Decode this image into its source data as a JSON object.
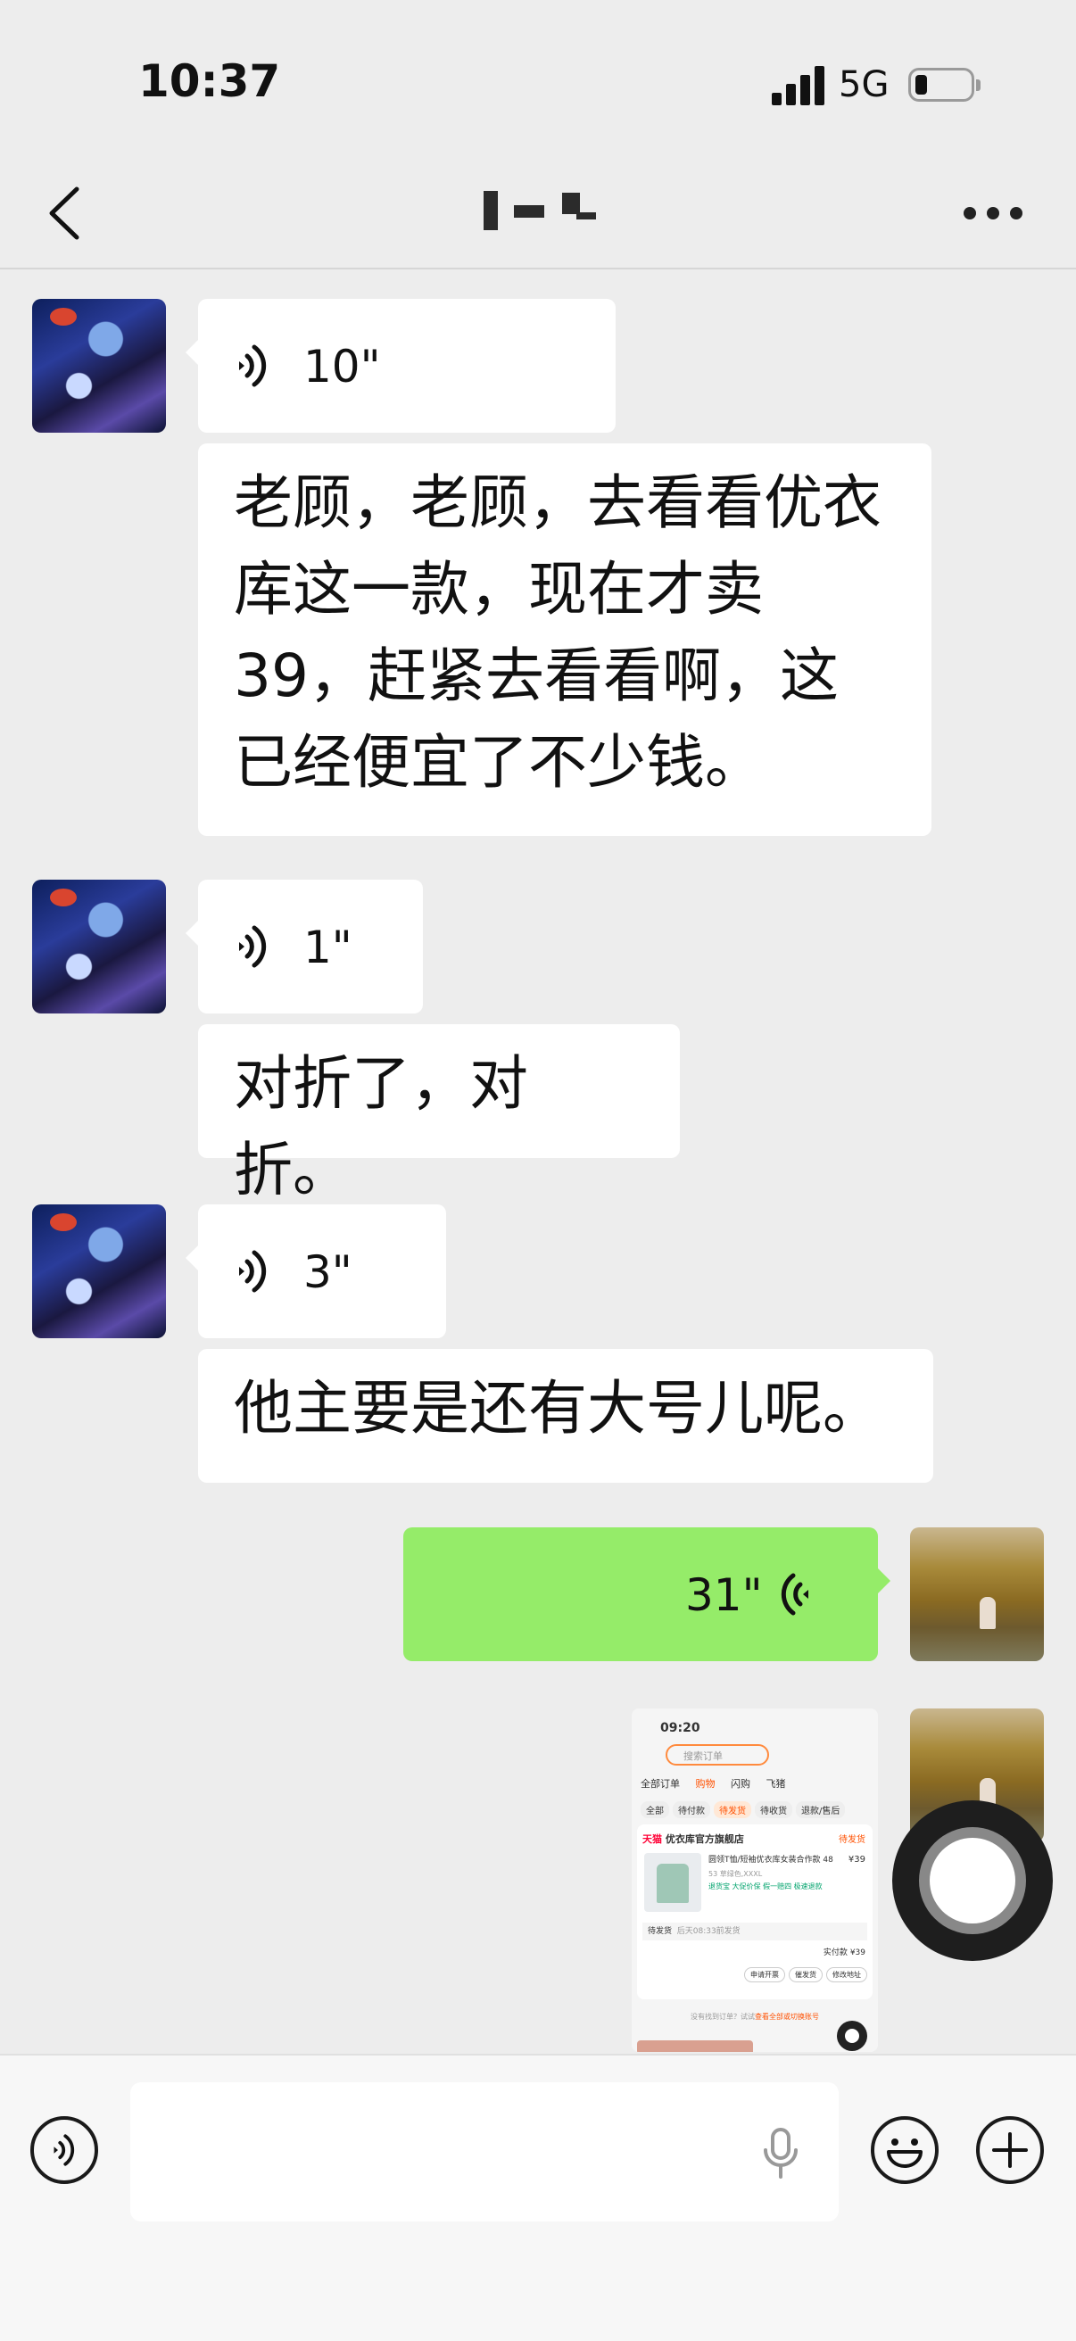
{
  "status_bar": {
    "time": "10:37",
    "network": "5G"
  },
  "nav": {
    "back_icon": "chevron-left-icon",
    "more_icon": "more-dots-icon"
  },
  "messages": [
    {
      "side": "left",
      "type": "voice",
      "duration": "10\""
    },
    {
      "side": "left",
      "type": "text",
      "text": "老顾，老顾，去看看优衣库这一款，现在才卖 39，赶紧去看看啊，这已经便宜了不少钱。"
    },
    {
      "side": "left",
      "type": "voice",
      "duration": "1\""
    },
    {
      "side": "left",
      "type": "text",
      "text": "对折了，对折。"
    },
    {
      "side": "left",
      "type": "voice",
      "duration": "3\""
    },
    {
      "side": "left",
      "type": "text",
      "text": "他主要是还有大号儿呢。"
    },
    {
      "side": "right",
      "type": "voice",
      "duration": "31\""
    },
    {
      "side": "right",
      "type": "image"
    }
  ],
  "screenshot_thumb": {
    "time": "09:20",
    "search_placeholder": "搜索订单",
    "tabs": [
      "全部订单",
      "购物",
      "闪购",
      "飞猪"
    ],
    "sub_tabs": [
      "全部",
      "待付款",
      "待发货",
      "待收货",
      "退款/售后"
    ],
    "store": "天猫",
    "store_name": "优衣库官方旗舰店",
    "status": "待发货",
    "product_name": "圆领T恤/短袖优衣库女装合作款 48",
    "unit_price": "¥39",
    "spec": "53 草绿色,XXXL",
    "tags": "退货宝  大促价保  假一赔四  极速退款",
    "shipping": "待发货",
    "shipping_note": "后天08:33前发货",
    "paid_label": "实付款",
    "paid": "¥39",
    "buttons": [
      "申请开票",
      "催发货",
      "修改地址"
    ],
    "footer_text": "没有找到订单？试试",
    "footer_link": "查看全部或切换账号"
  },
  "input_bar": {
    "voice_icon": "voice-mode-icon",
    "mic_icon": "microphone-icon",
    "emoji_icon": "emoji-icon",
    "plus_icon": "plus-icon"
  },
  "colors": {
    "background": "#ededed",
    "bubble_white": "#ffffff",
    "bubble_green": "#95ec69"
  }
}
